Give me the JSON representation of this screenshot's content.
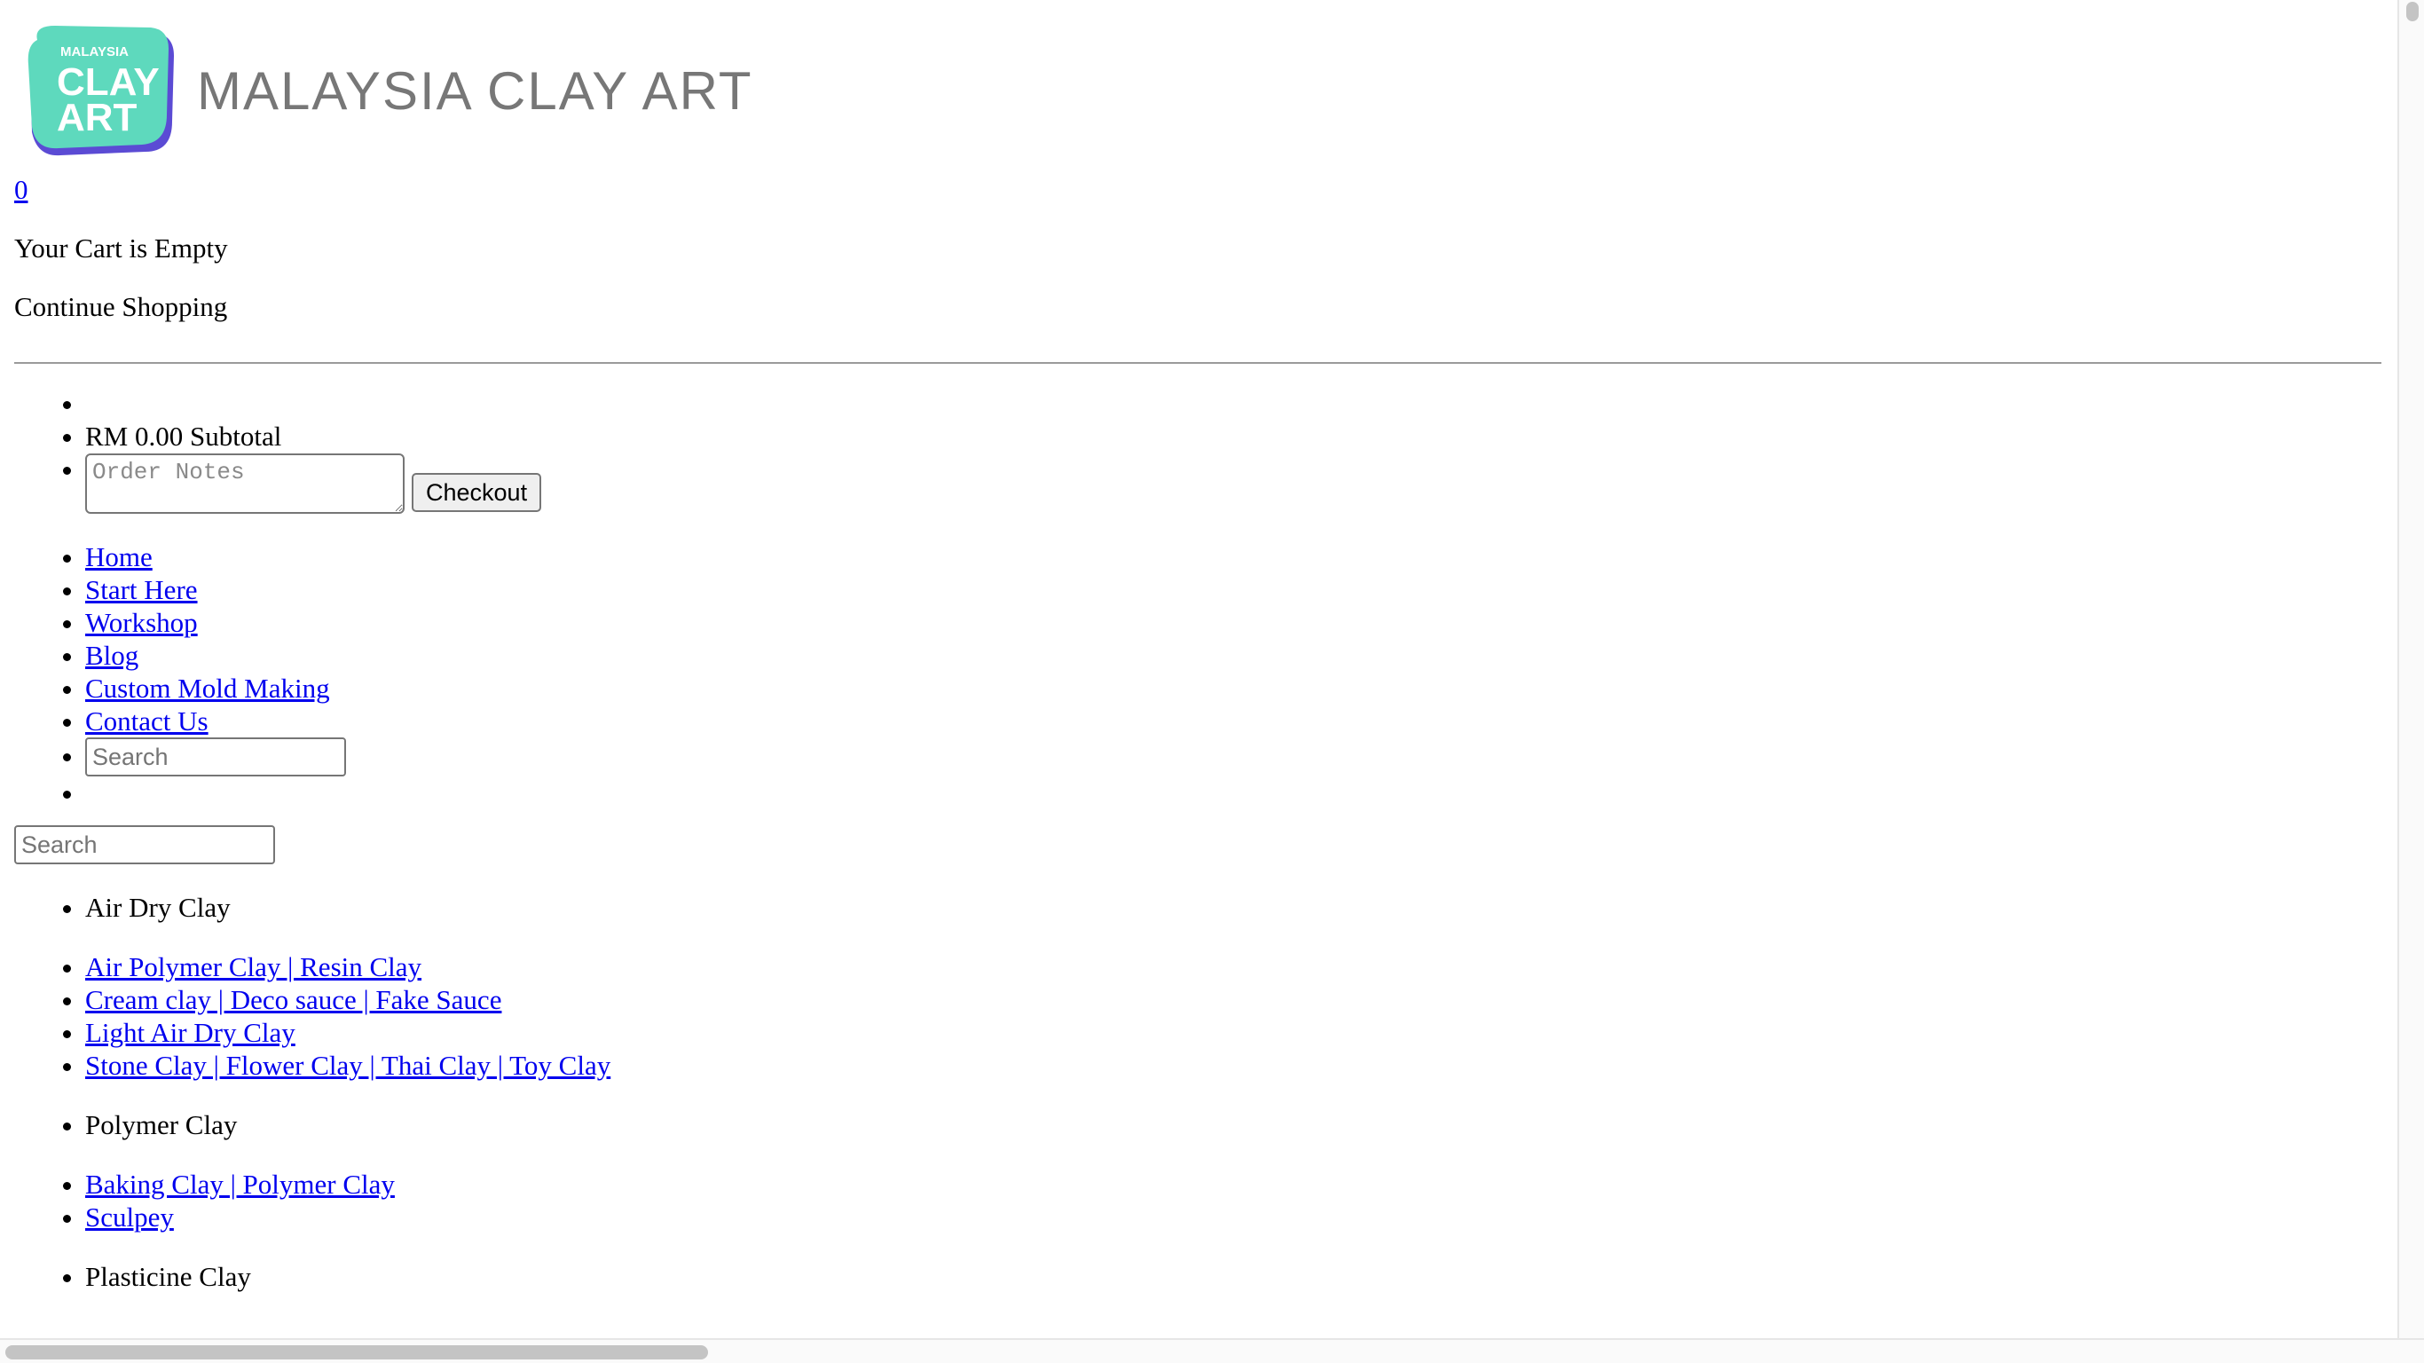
{
  "brand": {
    "badge_text_small": "MALAYSIA",
    "badge_text_line1": "CLAY",
    "badge_text_line2": "ART",
    "name": "MALAYSIA CLAY ART",
    "badge_color": "#5ed9bd",
    "badge_shadow_color": "#5b4bd4",
    "name_color": "#777777"
  },
  "cart": {
    "count": "0",
    "empty_text": "Your Cart is Empty",
    "continue_text": "Continue Shopping",
    "subtotal_text": "RM 0.00 Subtotal",
    "notes_placeholder": "Order Notes",
    "checkout_label": "Checkout"
  },
  "nav": {
    "items": [
      {
        "label": "Home"
      },
      {
        "label": "Start Here"
      },
      {
        "label": "Workshop"
      },
      {
        "label": "Blog"
      },
      {
        "label": "Custom Mold Making"
      },
      {
        "label": "Contact Us"
      }
    ],
    "search_placeholder": "Search"
  },
  "search": {
    "placeholder": "Search"
  },
  "categories": [
    {
      "name": "Air Dry Clay",
      "links": [
        {
          "label": "Air Polymer Clay | Resin Clay"
        },
        {
          "label": "Cream clay | Deco sauce | Fake Sauce"
        },
        {
          "label": "Light Air Dry Clay"
        },
        {
          "label": "Stone Clay | Flower Clay | Thai Clay | Toy Clay"
        }
      ]
    },
    {
      "name": "Polymer Clay",
      "links": [
        {
          "label": "Baking Clay | Polymer Clay"
        },
        {
          "label": "Sculpey"
        }
      ]
    },
    {
      "name": "Plasticine Clay",
      "links": []
    }
  ]
}
